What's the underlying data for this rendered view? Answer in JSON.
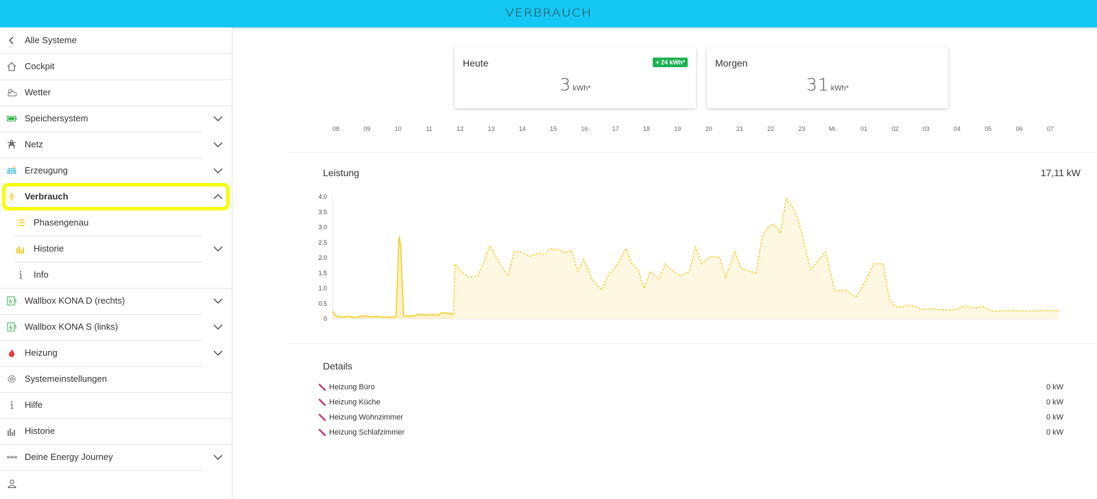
{
  "header": {
    "title": "VERBRAUCH"
  },
  "sidebar": {
    "back_label": "Alle Systeme",
    "items": [
      {
        "label": "Cockpit",
        "icon": "home-icon"
      },
      {
        "label": "Wetter",
        "icon": "weather-icon"
      },
      {
        "label": "Speichersystem",
        "icon": "battery-icon"
      },
      {
        "label": "Netz",
        "icon": "grid-tower-icon"
      },
      {
        "label": "Erzeugung",
        "icon": "solar-panel-icon"
      },
      {
        "label": "Verbrauch",
        "icon": "lightning-icon"
      },
      {
        "label": "Phasengenau",
        "icon": "list-icon"
      },
      {
        "label": "Historie",
        "icon": "bar-chart-icon"
      },
      {
        "label": "Info",
        "icon": "info-icon"
      },
      {
        "label": "Wallbox KONA D (rechts)",
        "icon": "wallbox-icon"
      },
      {
        "label": "Wallbox KONA S (links)",
        "icon": "wallbox-icon"
      },
      {
        "label": "Heizung",
        "icon": "flame-icon"
      },
      {
        "label": "Systemeinstellungen",
        "icon": "settings-icon"
      },
      {
        "label": "Hilfe",
        "icon": "info-icon"
      },
      {
        "label": "Historie",
        "icon": "bar-chart-icon"
      },
      {
        "label": "Deine Energy Journey",
        "icon": "journey-icon"
      }
    ]
  },
  "cards": {
    "today": {
      "title": "Heute",
      "value": "3",
      "unit": "kWh*",
      "badge": "+ 24 kWh*"
    },
    "tomorrow": {
      "title": "Morgen",
      "value": "31",
      "unit": "kWh*"
    }
  },
  "hours": [
    "08",
    "09",
    "10",
    "11",
    "12",
    "13",
    "14",
    "15",
    "16",
    "17",
    "18",
    "19",
    "20",
    "21",
    "22",
    "23",
    "Mi.",
    "01",
    "02",
    "03",
    "04",
    "05",
    "06",
    "07"
  ],
  "power": {
    "title": "Leistung",
    "value": "17,11 kW"
  },
  "details": {
    "title": "Details",
    "rows": [
      {
        "name": "Heizung Büro",
        "value": "0 kW"
      },
      {
        "name": "Heizung Küche",
        "value": "0 kW"
      },
      {
        "name": "Heizung Wohnzimmer",
        "value": "0 kW"
      },
      {
        "name": "Heizung Schlafzimmer",
        "value": "0 kW"
      }
    ]
  },
  "colors": {
    "accent": "#15c8f3",
    "series": "#f5cc1f",
    "badge": "#1bb150",
    "highlight": "#f6ff00"
  },
  "chart_data": {
    "type": "area",
    "title": "Leistung",
    "ylim": [
      0,
      4.0
    ],
    "yticks": [
      "4.0",
      "3.5",
      "3.0",
      "2.5",
      "2.0",
      "1.5",
      "1.0",
      "0.5",
      "0"
    ],
    "x_hours": [
      8.0,
      8.1,
      8.2,
      8.35,
      8.5,
      8.7,
      8.85,
      9.0,
      9.15,
      9.3,
      9.5,
      9.65,
      9.8,
      9.95,
      10.1,
      10.2,
      10.25,
      10.35,
      10.45,
      10.7,
      10.9,
      11.1,
      11.3,
      11.5,
      11.6,
      11.8,
      11.95,
      12.0
    ],
    "y_measured": [
      0.25,
      0.1,
      0.08,
      0.05,
      0.08,
      0.04,
      0.06,
      0.1,
      0.08,
      0.06,
      0.08,
      0.05,
      0.06,
      0.05,
      0.07,
      2.7,
      2.4,
      0.1,
      0.08,
      0.1,
      0.15,
      0.12,
      0.14,
      0.12,
      0.2,
      0.18,
      0.15,
      0.15
    ],
    "x_forecast": [
      12.0,
      12.05,
      12.2,
      12.5,
      12.8,
      13.0,
      13.2,
      13.4,
      13.6,
      13.8,
      14.0,
      14.2,
      14.5,
      14.8,
      15.0,
      15.2,
      15.5,
      15.7,
      15.9,
      16.1,
      16.3,
      16.6,
      16.9,
      17.1,
      17.4,
      17.7,
      17.9,
      18.1,
      18.3,
      18.5,
      18.8,
      19.0,
      19.2,
      19.5,
      19.8,
      20.0,
      20.2,
      20.5,
      20.8,
      21.0,
      21.3,
      21.5,
      21.8,
      22.0,
      22.2,
      22.4,
      22.6,
      22.8,
      23.0,
      23.3,
      23.5,
      23.8,
      24.0,
      24.3,
      24.6,
      24.9,
      25.1,
      25.3,
      25.6,
      25.9,
      26.2,
      26.4,
      26.6,
      26.8,
      27.0,
      27.2,
      27.5,
      27.8,
      28.0,
      28.3,
      28.6,
      28.9,
      29.2,
      29.5,
      29.8,
      30.0,
      30.3,
      30.6,
      31.0,
      31.4,
      31.8,
      32.0
    ],
    "y_forecast": [
      0.15,
      1.8,
      1.6,
      1.35,
      1.4,
      1.85,
      2.4,
      2.05,
      1.7,
      1.4,
      2.2,
      2.2,
      2.05,
      2.15,
      2.1,
      2.3,
      2.25,
      2.15,
      2.25,
      1.55,
      1.95,
      1.25,
      0.95,
      1.4,
      1.75,
      2.3,
      1.8,
      1.6,
      1.0,
      1.55,
      1.3,
      1.8,
      1.6,
      1.4,
      1.55,
      2.35,
      1.8,
      2.05,
      2.0,
      1.35,
      2.2,
      1.65,
      1.55,
      1.5,
      2.7,
      3.0,
      3.1,
      2.8,
      3.95,
      3.5,
      2.85,
      1.6,
      1.85,
      2.2,
      0.9,
      0.95,
      0.85,
      0.7,
      1.2,
      1.8,
      1.8,
      0.65,
      0.4,
      0.38,
      0.45,
      0.42,
      0.3,
      0.33,
      0.3,
      0.28,
      0.3,
      0.42,
      0.35,
      0.4,
      0.25,
      0.25,
      0.27,
      0.26,
      0.25,
      0.27,
      0.27,
      0.26
    ]
  }
}
